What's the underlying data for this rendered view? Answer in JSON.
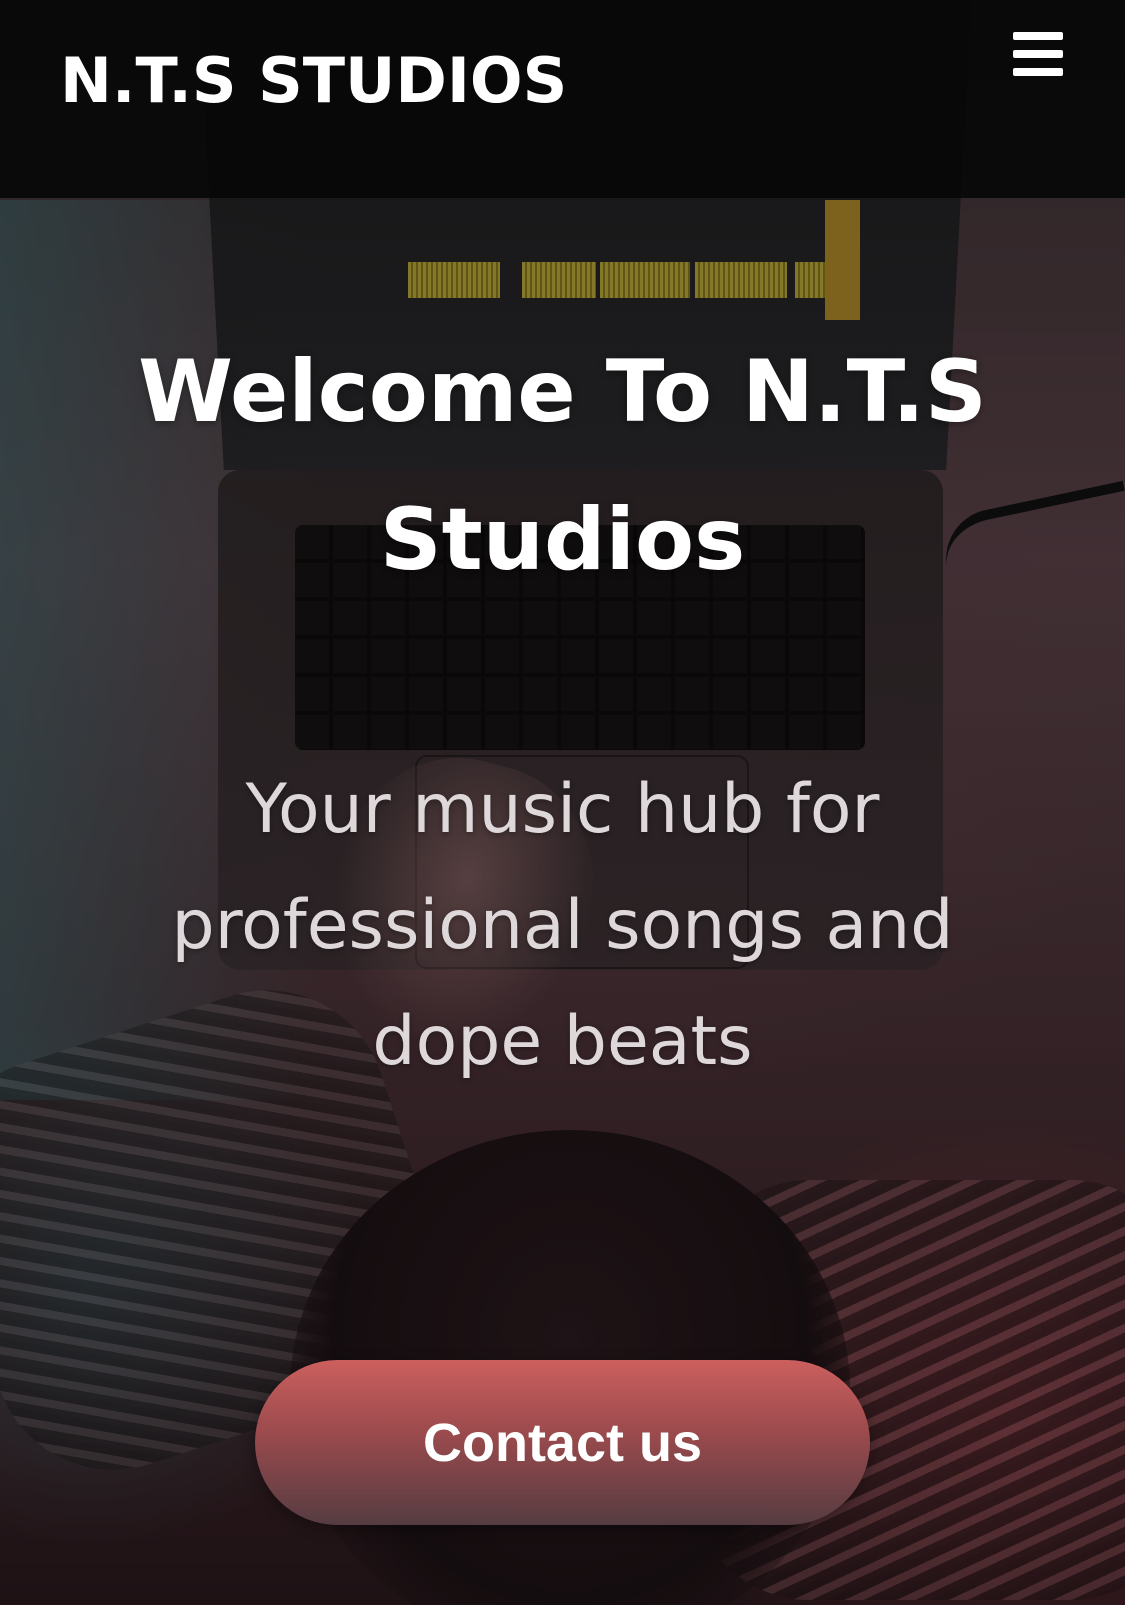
{
  "header": {
    "brand": "N.T.S STUDIOS",
    "menu_icon": "hamburger-menu-icon"
  },
  "hero": {
    "title": "Welcome To N.T.S Studios",
    "subtitle": "Your music hub for professional songs and dope beats",
    "cta_label": "Contact us"
  },
  "colors": {
    "header_bg": "#080808",
    "cta_top": "#cc5f5e",
    "cta_bottom": "#553c41",
    "title_text": "#ffffff",
    "subtitle_text": "#ded8da"
  }
}
